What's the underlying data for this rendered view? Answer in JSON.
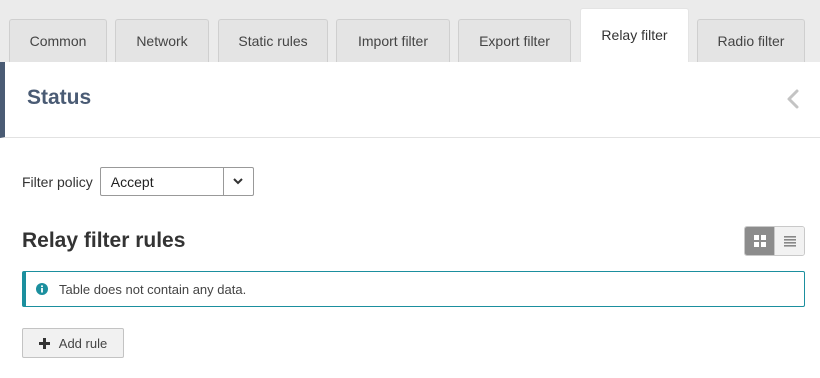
{
  "tabs": [
    {
      "label": "Common",
      "active": false
    },
    {
      "label": "Network",
      "active": false
    },
    {
      "label": "Static rules",
      "active": false
    },
    {
      "label": "Import filter",
      "active": false
    },
    {
      "label": "Export filter",
      "active": false
    },
    {
      "label": "Relay filter",
      "active": true
    },
    {
      "label": "Radio filter",
      "active": false
    }
  ],
  "status": {
    "title": "Status",
    "collapse_icon": "chevron-left-icon"
  },
  "filter_policy": {
    "label": "Filter policy",
    "value": "Accept",
    "dropdown_icon": "chevron-down-icon"
  },
  "rules": {
    "title": "Relay filter rules",
    "view_modes": [
      {
        "icon": "grid-view-icon",
        "active": true
      },
      {
        "icon": "list-view-icon",
        "active": false
      }
    ],
    "empty_message": "Table does not contain any data.",
    "info_icon": "info-icon",
    "add_button": {
      "label": "Add rule",
      "icon": "plus-icon"
    }
  },
  "colors": {
    "accent": "#4a5b74",
    "info": "#1b8f9e"
  }
}
